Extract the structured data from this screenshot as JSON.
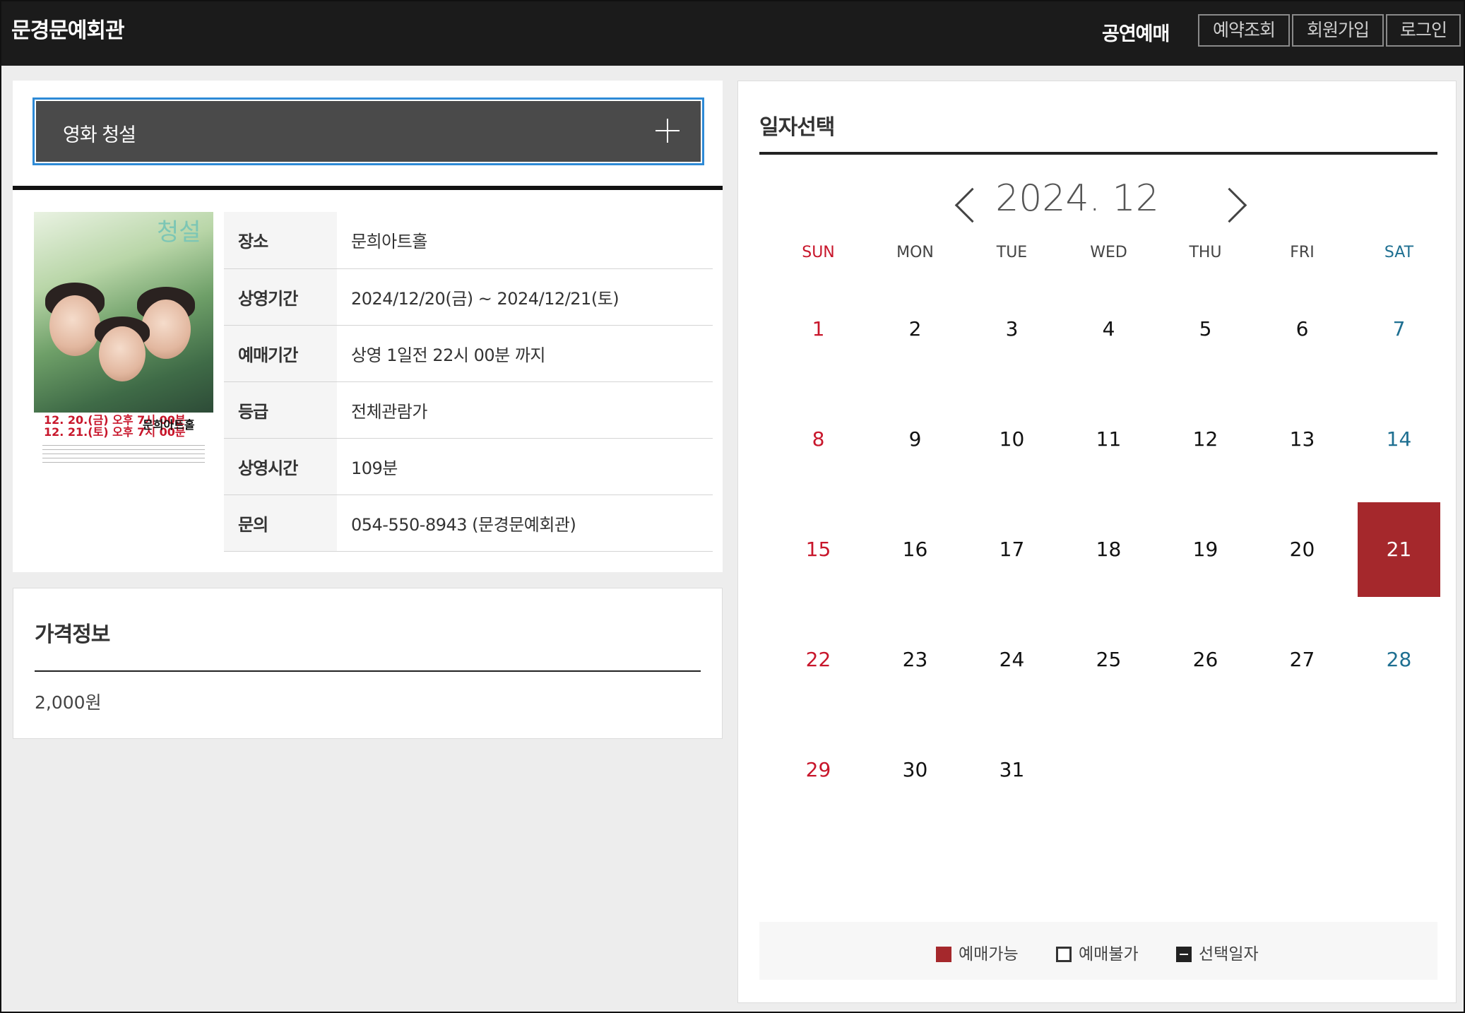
{
  "header": {
    "brand": "문경문예회관",
    "nav_book": "공연예매",
    "nav_buttons": [
      "예약조회",
      "회원가입",
      "로그인"
    ]
  },
  "event": {
    "title": "영화 청설",
    "poster": {
      "title_text": "청설",
      "date_line_1": "12. 20.(금) 오후 7시 00분",
      "date_line_2": "12. 21.(토) 오후 7시 00분",
      "venue": "문희아트홀"
    },
    "rows": [
      {
        "label": "장소",
        "value": "문희아트홀"
      },
      {
        "label": "상영기간",
        "value": "2024/12/20(금) ~ 2024/12/21(토)"
      },
      {
        "label": "예매기간",
        "value": "상영 1일전 22시 00분 까지"
      },
      {
        "label": "등급",
        "value": "전체관람가"
      },
      {
        "label": "상영시간",
        "value": "109분"
      },
      {
        "label": "문의",
        "value": "054-550-8943 (문경문예회관)"
      }
    ]
  },
  "price": {
    "title": "가격정보",
    "value": "2,000원"
  },
  "calendar": {
    "heading": "일자선택",
    "month_label": "2024. 12",
    "weekdays": [
      "SUN",
      "MON",
      "TUE",
      "WED",
      "THU",
      "FRI",
      "SAT"
    ],
    "days": [
      "1",
      "2",
      "3",
      "4",
      "5",
      "6",
      "7",
      "8",
      "9",
      "10",
      "11",
      "12",
      "13",
      "14",
      "15",
      "16",
      "17",
      "18",
      "19",
      "20",
      "21",
      "22",
      "23",
      "24",
      "25",
      "26",
      "27",
      "28",
      "29",
      "30",
      "31"
    ],
    "first_weekday_index": 0,
    "available_days": [
      "21"
    ],
    "colors": {
      "available": "#a5282c",
      "sunday": "#c8162b",
      "saturday": "#1e6f91"
    },
    "legend": [
      "예매가능",
      "예매불가",
      "선택일자"
    ]
  }
}
